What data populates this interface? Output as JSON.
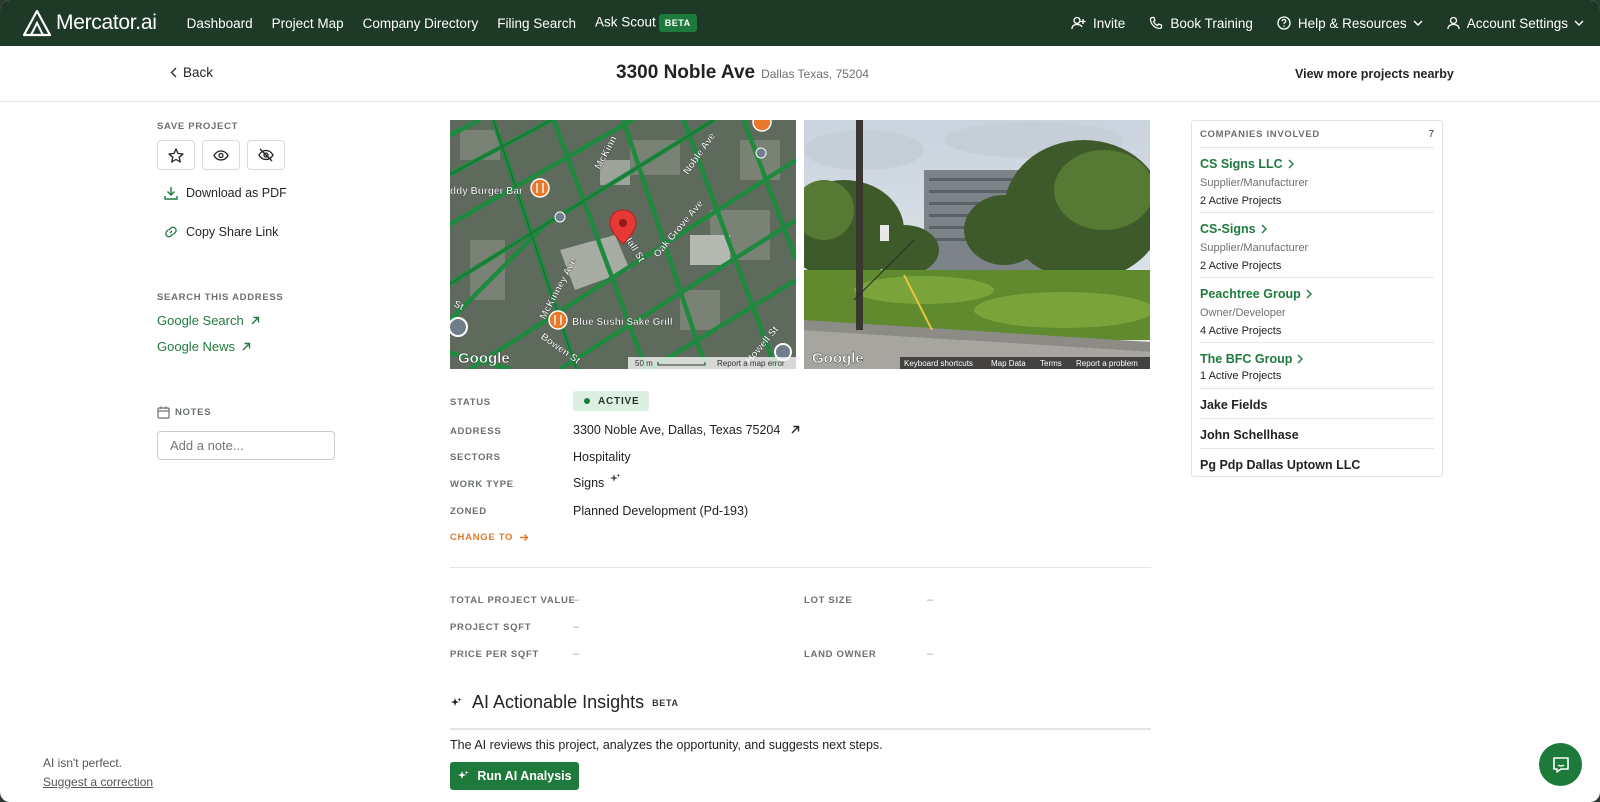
{
  "nav": {
    "logo_text": "Mercator.ai",
    "links": [
      "Dashboard",
      "Project Map",
      "Company Directory",
      "Filing Search",
      "Ask Scout"
    ],
    "beta_label": "BETA",
    "invite": "Invite",
    "book_training": "Book Training",
    "help": "Help & Resources",
    "account": "Account Settings"
  },
  "header": {
    "back": "Back",
    "title": "3300 Noble Ave",
    "subtitle": "Dallas Texas, 75204",
    "view_more": "View more projects nearby"
  },
  "sidebar": {
    "save_label": "SAVE PROJECT",
    "download_pdf": "Download as PDF",
    "copy_link": "Copy Share Link",
    "search_label": "SEARCH THIS ADDRESS",
    "google_search": "Google Search",
    "google_news": "Google News",
    "notes_label": "NOTES",
    "notes_placeholder": "Add a note..."
  },
  "map": {
    "streets": [
      "McKinney Ave",
      "N Hall St",
      "Oak Grove Ave",
      "Noble Ave",
      "Bowen St",
      "Howell St",
      "McKinn",
      "St"
    ],
    "places": [
      "ddy Burger Bar",
      "Blue Sushi Sake Grill"
    ],
    "google": "Google",
    "scale": "50 m",
    "report": "Report a map error"
  },
  "street_view": {
    "google": "Google",
    "links": [
      "Keyboard shortcuts",
      "Map Data",
      "Terms",
      "Report a problem"
    ]
  },
  "details": {
    "status_label": "STATUS",
    "status_value": "ACTIVE",
    "address_label": "ADDRESS",
    "address_value": "3300 Noble Ave, Dallas, Texas 75204",
    "sectors_label": "SECTORS",
    "sectors_value": "Hospitality",
    "worktype_label": "WORK TYPE",
    "worktype_value": "Signs",
    "zoned_label": "ZONED",
    "zoned_value": "Planned Development (Pd-193)",
    "change_to": "CHANGE TO"
  },
  "financials": {
    "total_value_label": "TOTAL PROJECT VALUE",
    "total_value": "–",
    "sqft_label": "PROJECT SQFT",
    "sqft": "–",
    "price_label": "PRICE PER SQFT",
    "price": "–",
    "lot_label": "LOT SIZE",
    "lot": "–",
    "owner_label": "LAND OWNER",
    "owner": "–"
  },
  "ai": {
    "title": "AI Actionable Insights",
    "beta": "BETA",
    "description": "The AI reviews this project, analyzes the opportunity, and suggests next steps.",
    "button": "Run AI Analysis"
  },
  "companies": {
    "label": "COMPANIES INVOLVED",
    "count": "7",
    "items": [
      {
        "name": "CS Signs LLC",
        "role": "Supplier/Manufacturer",
        "projects": "2 Active Projects"
      },
      {
        "name": "CS-Signs",
        "role": "Supplier/Manufacturer",
        "projects": "2 Active Projects"
      },
      {
        "name": "Peachtree Group",
        "role": "Owner/Developer",
        "projects": "4 Active Projects"
      },
      {
        "name": "The BFC Group",
        "projects": "1 Active Projects"
      }
    ],
    "people": [
      "Jake Fields",
      "John Schellhase",
      "Pg Pdp Dallas Uptown LLC"
    ]
  },
  "footer": {
    "ai_note": "AI isn't perfect.",
    "suggest": "Suggest a correction"
  },
  "colors": {
    "nav_bg": "#1e3a26",
    "accent_green": "#1f7a3e",
    "change_orange": "#e07b2c"
  }
}
